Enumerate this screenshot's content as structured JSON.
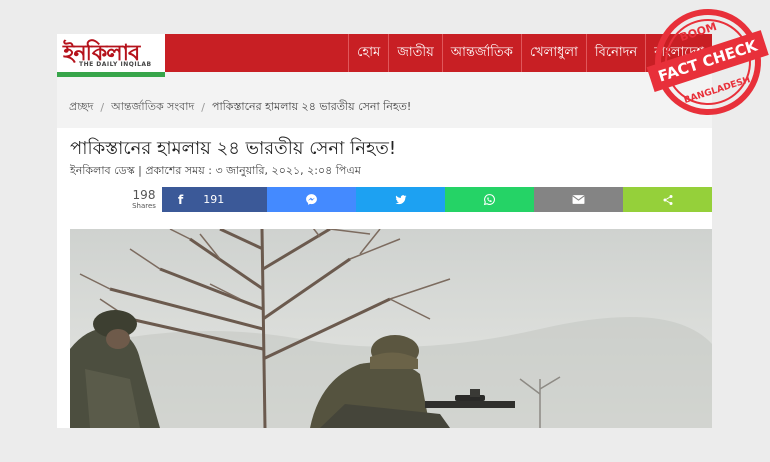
{
  "header": {
    "logo_text": "ইনকিলাব",
    "logo_sub": "THE DAILY INQILAB",
    "nav": [
      "হোম",
      "জাতীয়",
      "আন্তর্জাতিক",
      "খেলাধুলা",
      "বিনোদন",
      "বাংলাদেশ"
    ]
  },
  "breadcrumb": {
    "items": [
      "প্রচ্ছদ",
      "আন্তর্জাতিক সংবাদ",
      "পাকিস্তানের হামলায় ২৪ ভারতীয় সেনা নিহত!"
    ]
  },
  "article": {
    "title": "পাকিস্তানের হামলায় ২৪ ভারতীয় সেনা নিহত!",
    "meta": "ইনকিলাব ডেস্ক | প্রকাশের সময় : ৩ জানুয়ারি, ২০২১, ২:০৪ পিএম"
  },
  "share": {
    "total": "198",
    "total_label": "Shares",
    "facebook_count": "191",
    "buttons": [
      {
        "name": "facebook",
        "color": "#3b5998",
        "icon": "facebook-icon"
      },
      {
        "name": "messenger",
        "color": "#448aff",
        "icon": "messenger-icon"
      },
      {
        "name": "twitter",
        "color": "#1da1f2",
        "icon": "twitter-icon"
      },
      {
        "name": "whatsapp",
        "color": "#25d366",
        "icon": "whatsapp-icon"
      },
      {
        "name": "email",
        "color": "#848484",
        "icon": "email-icon"
      },
      {
        "name": "sharethis",
        "color": "#95d03a",
        "icon": "share-icon"
      }
    ]
  },
  "stamp": {
    "brand": "BOOM",
    "label": "FACT CHECK",
    "region": "BANGLADESH",
    "color": "#e8303a"
  }
}
